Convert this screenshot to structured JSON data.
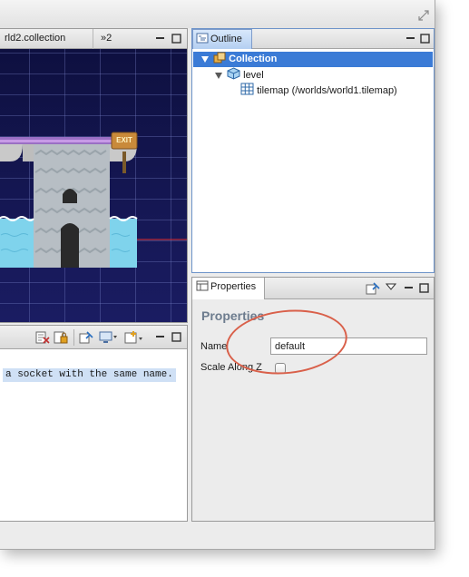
{
  "window": {
    "resize_icon": "resize-diagonal-icon"
  },
  "editor": {
    "tabs": [
      {
        "label": "rld2.collection"
      },
      {
        "label": "»2"
      }
    ],
    "scene": {
      "exit_sign_text": "EXIT"
    }
  },
  "outline": {
    "tab_label": "Outline",
    "tree": [
      {
        "label": "Collection",
        "icon": "collection-icon",
        "selected": true,
        "expanded": true
      },
      {
        "label": "level",
        "icon": "cube-icon",
        "expanded": true
      },
      {
        "label": "tilemap (/worlds/world1.tilemap)",
        "icon": "tilemap-grid-icon"
      }
    ]
  },
  "properties": {
    "tab_label": "Properties",
    "heading": "Properties",
    "fields": {
      "name_label": "Name",
      "name_value": "default",
      "scale_label": "Scale Along Z",
      "scale_checked": false
    }
  },
  "console": {
    "message": "a socket with the same name."
  },
  "colors": {
    "selection": "#3b7bd6",
    "tab_active": "#b4cff1",
    "scene_bg": "#14165a",
    "annotation": "#d9604a",
    "console_highlight": "#cfe0f5"
  }
}
